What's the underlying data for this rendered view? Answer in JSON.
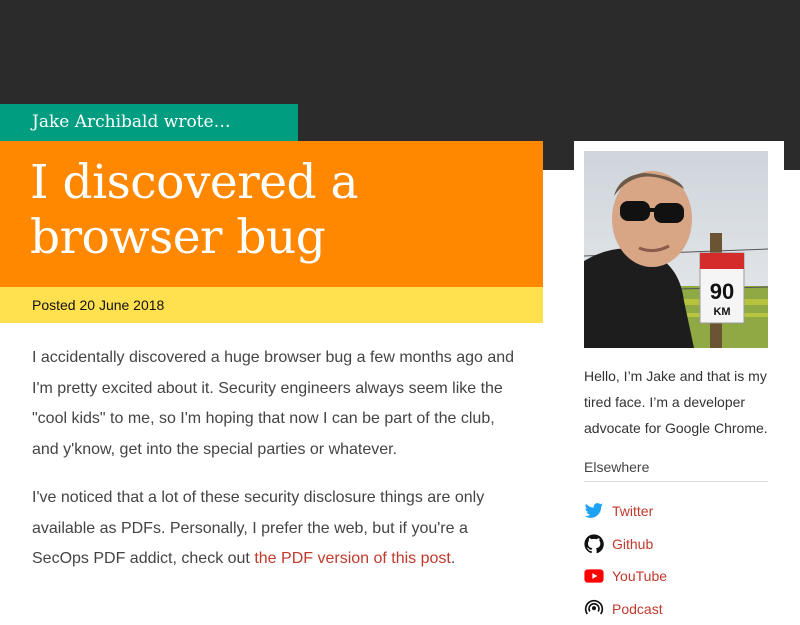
{
  "header": {
    "author": "Jake Archibald wrote…",
    "title_line1": "I discovered a",
    "title_line2": "browser bug",
    "posted": "Posted 20 June 2018"
  },
  "article": {
    "p1": "I accidentally discovered a huge browser bug a few months ago and I'm pretty excited about it. Security engineers always seem like the \"cool kids\" to me, so I'm hoping that now I can be part of the club, and y'know, get into the special parties or whatever.",
    "p2_text": "I've noticed that a lot of these security disclosure things are only available as PDFs. Personally, I prefer the web, but if you're a SecOps PDF addict, check out ",
    "p2_link": "the PDF version of this post",
    "p2_end": "."
  },
  "sidebar": {
    "bio": "Hello, I’m Jake and that is my tired face. I’m a developer advocate for Google Chrome.",
    "elsewhere": "Elsewhere",
    "photo_sign": {
      "top": "90",
      "bottom": "KM"
    },
    "links": [
      {
        "label": "Twitter",
        "icon": "twitter-icon"
      },
      {
        "label": "Github",
        "icon": "github-icon"
      },
      {
        "label": "YouTube",
        "icon": "youtube-icon"
      },
      {
        "label": "Podcast",
        "icon": "podcast-icon"
      }
    ]
  },
  "colors": {
    "topbar": "#2b2b2b",
    "author_tab": "#009d81",
    "title_bg": "#ff8800",
    "posted_bg": "#ffe14f",
    "link": "#c0392b"
  }
}
